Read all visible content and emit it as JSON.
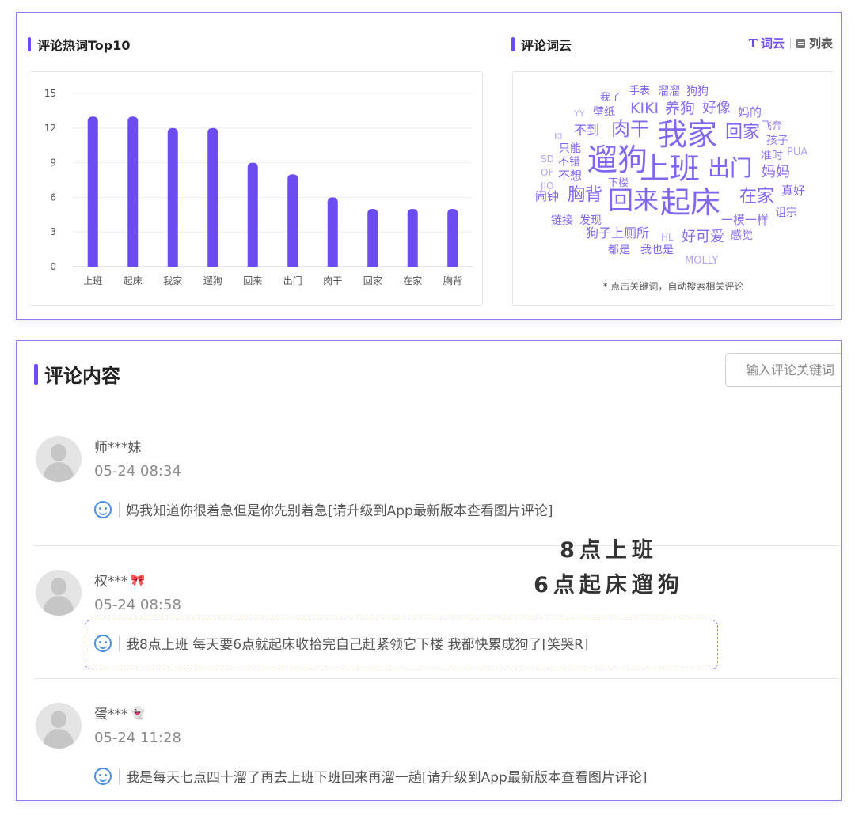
{
  "hotwords": {
    "title": "评论热词Top10"
  },
  "cloud": {
    "title": "评论词云",
    "toggle_cloud_icon": "T",
    "toggle_cloud": "词云",
    "toggle_list": "列表",
    "note": "* 点击关键词，自动搜索相关评论",
    "words": [
      "我了",
      "手表",
      "溜溜",
      "狗狗",
      "YY",
      "壁纸",
      "KIKI",
      "养狗",
      "好像",
      "妈的",
      "不到",
      "肉干",
      "我家",
      "回家",
      "飞奔",
      "KI",
      "孩子",
      "只能",
      "准时",
      "PUA",
      "SD",
      "不错",
      "遛狗",
      "上班",
      "出门",
      "妈妈",
      "OF",
      "不想",
      "JIO",
      "下楼",
      "真好",
      "闹钟",
      "胸背",
      "回来",
      "起床",
      "在家",
      "链接",
      "发现",
      "一模一样",
      "诅宗",
      "狗子上厕所",
      "HL",
      "好可爱",
      "感觉",
      "都是",
      "我也是",
      "MOLLY"
    ],
    "word_color": "#6c4cf0"
  },
  "chart_data": {
    "type": "bar",
    "categories": [
      "上班",
      "起床",
      "我家",
      "遛狗",
      "回来",
      "出门",
      "肉干",
      "回家",
      "在家",
      "胸背"
    ],
    "values": [
      13,
      13,
      12,
      12,
      9,
      8,
      6,
      5,
      5,
      5
    ],
    "yticks": [
      "0",
      "3",
      "6",
      "9",
      "12",
      "15"
    ],
    "ylim": [
      0,
      15
    ],
    "bar_color": "#6c4cf0",
    "grid": true
  },
  "comments": {
    "title": "评论内容",
    "search_placeholder": "输入评论关键词",
    "items": [
      {
        "user": "师***妹",
        "emoji": "",
        "time": "05-24 08:34",
        "text": "妈我知道你很着急但是你先别着急[请升级到App最新版本查看图片评论]"
      },
      {
        "user": "权***",
        "emoji": "🎀",
        "time": "05-24 08:58",
        "text": "我8点上班 每天要6点就起床收拾完自己赶紧领它下楼 我都快累成狗了[笑哭R]"
      },
      {
        "user": "蛋***",
        "emoji": "👻",
        "time": "05-24 11:28",
        "text": "我是每天七点四十溜了再去上班下班回来再溜一趟[请升级到App最新版本查看图片评论]"
      }
    ]
  },
  "callout": {
    "line1": "8点上班",
    "line2": "6点起床遛狗"
  },
  "colors": {
    "accent": "#6c4cf0",
    "panel_border": "#8c7df0",
    "smile_icon": "#4b8fe0"
  }
}
